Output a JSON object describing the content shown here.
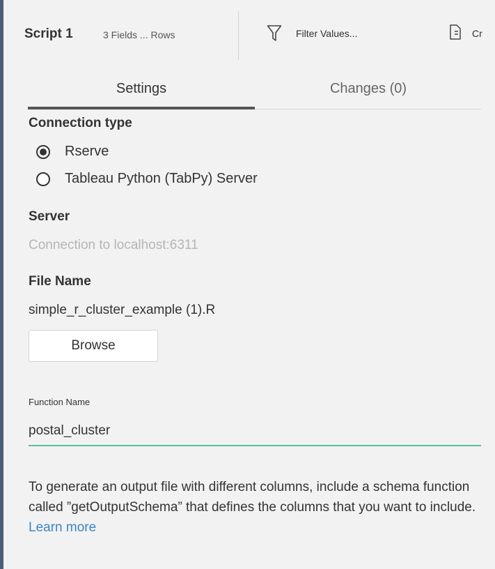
{
  "header": {
    "title": "Script 1",
    "meta": "3 Fields  ... Rows",
    "filter_label": "Filter Values...",
    "create_label": "Cr"
  },
  "tabs": [
    {
      "label": "Settings",
      "active": true
    },
    {
      "label": "Changes (0)",
      "active": false
    }
  ],
  "connection": {
    "title": "Connection type",
    "options": [
      {
        "label": "Rserve",
        "selected": true
      },
      {
        "label": "Tableau Python (TabPy) Server",
        "selected": false
      }
    ]
  },
  "server": {
    "title": "Server",
    "value": "Connection to localhost:6311"
  },
  "file": {
    "title": "File Name",
    "value": "simple_r_cluster_example (1).R",
    "browse_label": "Browse"
  },
  "function": {
    "label": "Function Name",
    "value": "postal_cluster"
  },
  "info": {
    "text": "To generate an output file with different columns, include a schema function called ”getOutputSchema” that defines the columns that you want to include. ",
    "link": "Learn more"
  },
  "colors": {
    "accent_input_underline": "#5bbf99",
    "link": "#3d86c6",
    "tab_indicator": "#555555",
    "left_border": "#4a5e7a"
  },
  "icons": {
    "filter": "filter-icon",
    "create": "create-calculated-field-icon"
  }
}
